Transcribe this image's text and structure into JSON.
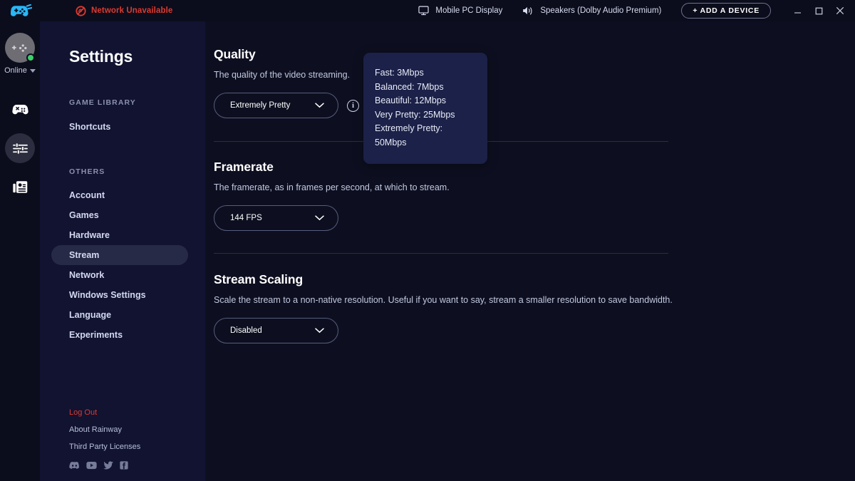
{
  "titlebar": {
    "logo_icon": "gamepad-logo-icon",
    "network_icon": "network-unavailable-icon",
    "network_status": "Network Unavailable",
    "display_icon": "monitor-icon",
    "display_label": "Mobile PC Display",
    "speaker_icon": "speaker-icon",
    "speaker_label": "Speakers (Dolby Audio Premium)",
    "add_device_label": "+ ADD A DEVICE",
    "minimize_icon": "minimize-icon",
    "maximize_icon": "maximize-icon",
    "close_icon": "close-icon"
  },
  "rail": {
    "avatar_icon": "gamepad-avatar-icon",
    "presence_label": "Online",
    "presence_caret_icon": "chevron-down-icon",
    "items": [
      {
        "icon": "gamepad-library-icon",
        "active": false
      },
      {
        "icon": "sliders-settings-icon",
        "active": true
      },
      {
        "icon": "news-article-icon",
        "active": false
      }
    ]
  },
  "sidebar": {
    "title": "Settings",
    "group_game_library": "GAME LIBRARY",
    "game_library_items": [
      {
        "label": "Shortcuts",
        "selected": false
      }
    ],
    "group_others": "OTHERS",
    "other_items": [
      {
        "label": "Account",
        "selected": false
      },
      {
        "label": "Games",
        "selected": false
      },
      {
        "label": "Hardware",
        "selected": false
      },
      {
        "label": "Stream",
        "selected": true
      },
      {
        "label": "Network",
        "selected": false
      },
      {
        "label": "Windows Settings",
        "selected": false
      },
      {
        "label": "Language",
        "selected": false
      },
      {
        "label": "Experiments",
        "selected": false
      }
    ],
    "footer": {
      "logout": "Log Out",
      "about": "About Rainway",
      "licenses": "Third Party Licenses",
      "socials": [
        {
          "icon": "discord-icon"
        },
        {
          "icon": "youtube-icon"
        },
        {
          "icon": "twitter-icon"
        },
        {
          "icon": "facebook-icon"
        }
      ]
    }
  },
  "main": {
    "quality": {
      "title": "Quality",
      "description": "The quality of the video streaming.",
      "value": "Extremely Pretty",
      "chevron_icon": "chevron-down-icon",
      "info_icon": "info-icon",
      "info_glyph": "i"
    },
    "framerate": {
      "title": "Framerate",
      "description": "The framerate, as in frames per second, at which to stream.",
      "value": "144 FPS",
      "chevron_icon": "chevron-down-icon"
    },
    "stream_scaling": {
      "title": "Stream Scaling",
      "description": "Scale the stream to a non-native resolution. Useful if you want to say, stream a smaller resolution to save bandwidth.",
      "value": "Disabled",
      "chevron_icon": "chevron-down-icon"
    }
  },
  "tooltip": {
    "lines": [
      "Fast: 3Mbps",
      "Balanced: 7Mbps",
      "Beautiful: 12Mbps",
      "Very Pretty: 25Mbps",
      "Extremely Pretty:",
      "50Mbps"
    ]
  },
  "colors": {
    "accent_red": "#e0392f",
    "logo_blue": "#29b6f6",
    "online_green": "#3ecf6b",
    "tooltip_bg": "#1b2148",
    "sidebar_bg": "#111331",
    "content_bg": "#0d0f20"
  }
}
